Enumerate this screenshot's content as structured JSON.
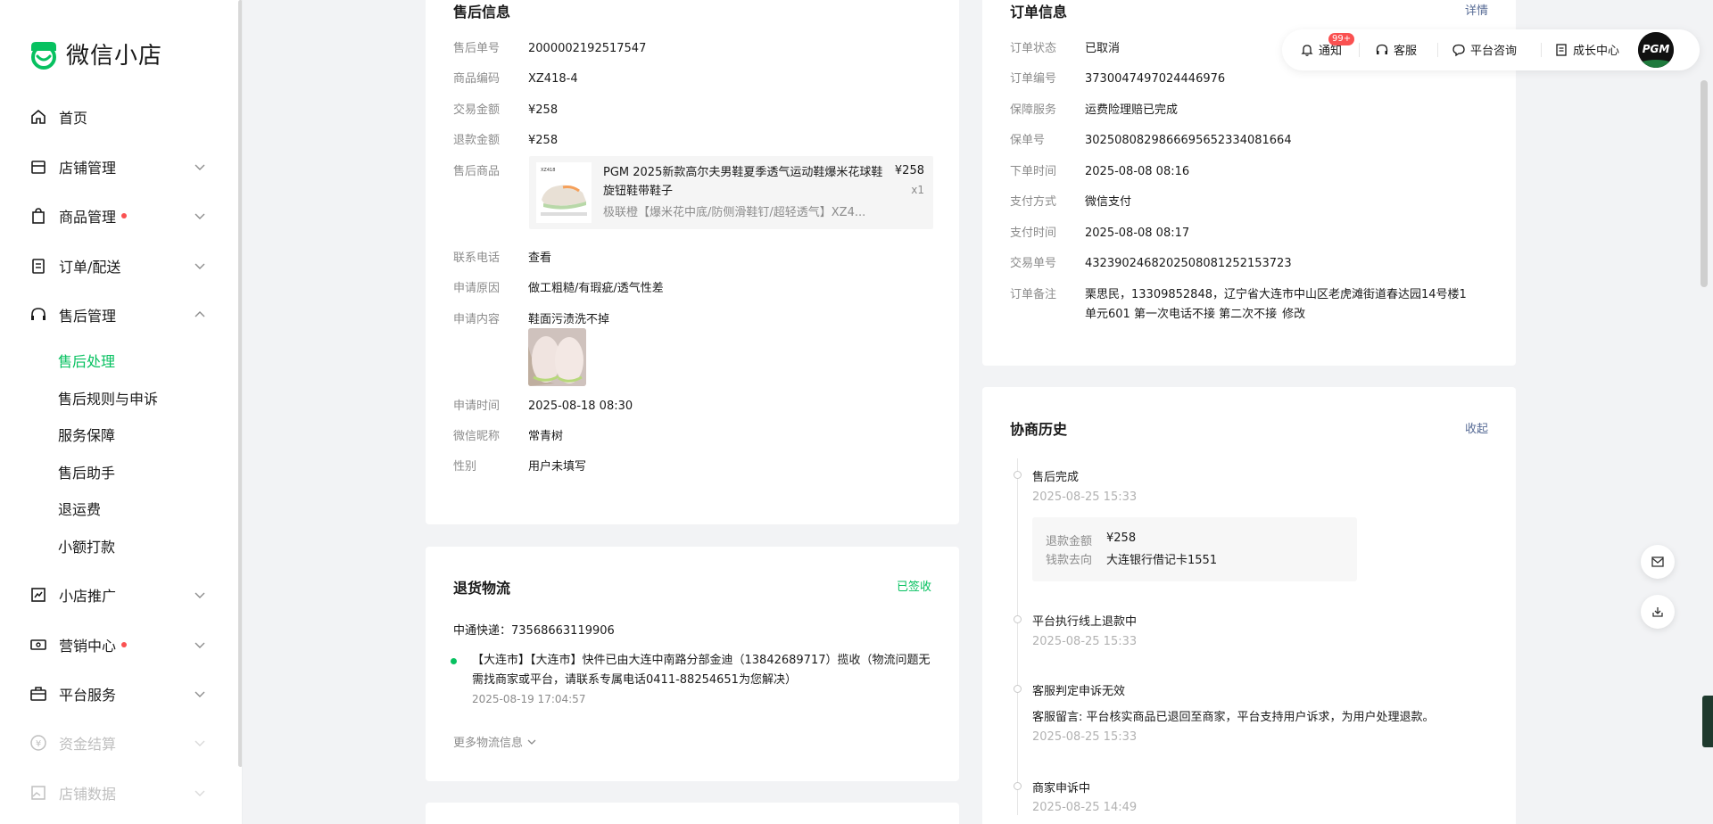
{
  "brand": {
    "name": "微信小店",
    "color": "#07c160"
  },
  "sidebar": {
    "items": [
      {
        "label": "首页",
        "icon": "home-icon"
      },
      {
        "label": "店铺管理",
        "icon": "store-icon"
      },
      {
        "label": "商品管理",
        "icon": "bag-icon",
        "dot": true
      },
      {
        "label": "订单/配送",
        "icon": "clipboard-icon"
      },
      {
        "label": "售后管理",
        "icon": "headset-icon",
        "expanded": true
      },
      {
        "label": "小店推广",
        "icon": "trend-icon"
      },
      {
        "label": "营销中心",
        "icon": "ticket-icon",
        "dot": true
      },
      {
        "label": "平台服务",
        "icon": "briefcase-icon"
      },
      {
        "label": "资金结算",
        "icon": "yuan-icon",
        "disabled": true
      },
      {
        "label": "店铺数据",
        "icon": "image-icon",
        "disabled": true
      }
    ],
    "subitems": [
      "售后处理",
      "售后规则与申诉",
      "服务保障",
      "售后助手",
      "退运费",
      "小额打款"
    ]
  },
  "after_sale": {
    "title": "售后信息",
    "rows": [
      {
        "k": "售后单号",
        "v": "2000002192517547"
      },
      {
        "k": "商品编码",
        "v": "XZ418-4"
      },
      {
        "k": "交易金额",
        "v": "¥258"
      },
      {
        "k": "退款金额",
        "v": "¥258"
      }
    ],
    "product_label": "售后商品",
    "product": {
      "title": "PGM 2025新款高尔夫男鞋夏季透气运动鞋爆米花球鞋旋钮鞋带鞋子",
      "spec": "极联橙【爆米花中底/防侧滑鞋钉/超轻透气】XZ4...",
      "price": "¥258",
      "qty": "x1"
    },
    "phone_label": "联系电话",
    "phone_link": "查看",
    "reason_label": "申请原因",
    "reason": "做工粗糙/有瑕疵/透气性差",
    "content_label": "申请内容",
    "content": "鞋面污渍洗不掉",
    "rows2": [
      {
        "k": "申请时间",
        "v": "2025-08-18 08:30"
      },
      {
        "k": "微信昵称",
        "v": "常青树"
      },
      {
        "k": "性别",
        "v": "用户未填写"
      }
    ]
  },
  "logistics": {
    "title": "退货物流",
    "status": "已签收",
    "carrier": "中通快递：73568663119906",
    "event": "【大连市】【大连市】快件已由大连中南路分部金迪（13842689717）揽收（物流问题无需找商家或平台，请联系专属电话0411-88254651为您解决）",
    "event_time": "2025-08-19 17:04:57",
    "more": "更多物流信息"
  },
  "order": {
    "title": "订单信息",
    "detail": "详情",
    "rows": [
      {
        "k": "订单状态",
        "v": "已取消"
      },
      {
        "k": "订单编号",
        "v": "3730047497024446976"
      },
      {
        "k": "保障服务",
        "v": "运费险理赔已完成"
      },
      {
        "k": "保单号",
        "v": "30250808298666956523340816​64"
      },
      {
        "k": "下单时间",
        "v": "2025-08-08 08:16"
      },
      {
        "k": "支付方式",
        "v": "微信支付"
      },
      {
        "k": "支付时间",
        "v": "2025-08-08 08:17"
      },
      {
        "k": "交易单号",
        "v": "4323902468202508081252153723"
      }
    ],
    "remark_label": "订单备注",
    "remark_line1": "栗思民，13309852848，辽宁省大连市中山区老虎滩街道春达园14号楼1",
    "remark_line2": "单元601 第一次电话不接 第二次不接",
    "remark_edit": "修改"
  },
  "history": {
    "title": "协商历史",
    "collapse": "收起",
    "events": [
      {
        "title": "售后完成",
        "time": "2025-08-25 15:33"
      },
      {
        "title": "平台执行线上退款中",
        "time": "2025-08-25 15:33"
      },
      {
        "title": "客服判定申诉无效",
        "time": "2025-08-25 15:33"
      },
      {
        "title": "商家申诉中",
        "time": "2025-08-25 14:49"
      }
    ],
    "refund_label": "退款金额",
    "refund_value": "¥258",
    "dest_label": "钱款去向",
    "dest_value": "大连银行借记卡1551",
    "service_note": "客服留言: 平台核实商品已退回至商家，平台支持用户诉求，为用户处理退款。"
  },
  "topbar": {
    "notify": "通知",
    "notify_badge": "99+",
    "service": "客服",
    "consult": "平台咨询",
    "growth": "成长中心",
    "avatar_text": "PGM"
  }
}
